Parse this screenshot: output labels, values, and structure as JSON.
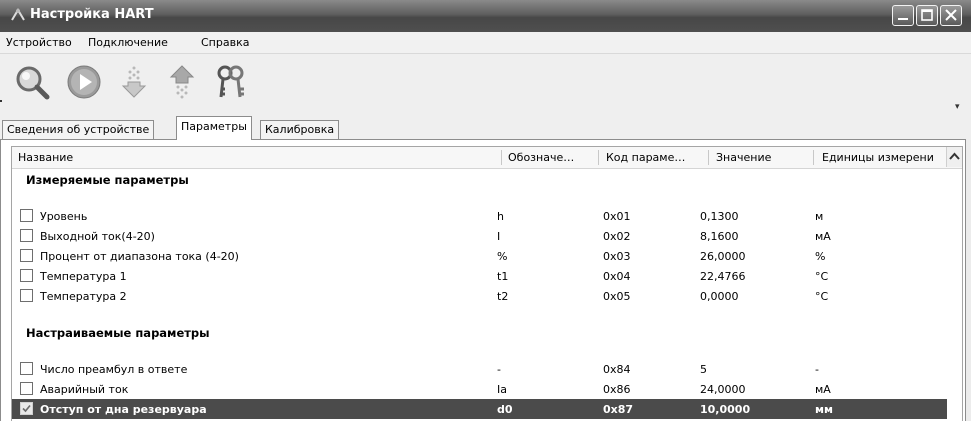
{
  "window": {
    "title": "Настройка HART"
  },
  "menu": {
    "items": [
      "Устройство",
      "Подключение",
      "Справка"
    ]
  },
  "toolbar": {
    "tools": [
      "search-icon",
      "play-icon",
      "download-arrow-icon",
      "upload-arrow-icon",
      "keys-icon"
    ],
    "overflow": "▾"
  },
  "tabs": {
    "items": [
      "Сведения об устройстве",
      "Параметры",
      "Калибровка"
    ],
    "active": "Параметры"
  },
  "table": {
    "columns": [
      "Название",
      "Обозначе…",
      "Код параме…",
      "Значение",
      "Единицы измерени"
    ],
    "groups": [
      {
        "label": "Измеряемые параметры",
        "rows": [
          {
            "name": "Уровень",
            "symbol": "h",
            "code": "0x01",
            "value": "0,1300",
            "unit": "м",
            "checked": false
          },
          {
            "name": "Выходной ток(4-20)",
            "symbol": "I",
            "code": "0x02",
            "value": "8,1600",
            "unit": "мА",
            "checked": false
          },
          {
            "name": "Процент от диапазона тока (4-20)",
            "symbol": "%",
            "code": "0x03",
            "value": "26,0000",
            "unit": "%",
            "checked": false
          },
          {
            "name": "Температура 1",
            "symbol": "t1",
            "code": "0x04",
            "value": "22,4766",
            "unit": "°C",
            "checked": false
          },
          {
            "name": "Температура 2",
            "symbol": "t2",
            "code": "0x05",
            "value": "0,0000",
            "unit": "°C",
            "checked": false
          }
        ]
      },
      {
        "label": "Настраиваемые параметры",
        "rows": [
          {
            "name": "Число преамбул в ответе",
            "symbol": "-",
            "code": "0x84",
            "value": "5",
            "unit": "-",
            "checked": false
          },
          {
            "name": "Аварийный ток",
            "symbol": "Ia",
            "code": "0x86",
            "value": "24,0000",
            "unit": "мА",
            "checked": false
          },
          {
            "name": "Отступ от дна резервуара",
            "symbol": "d0",
            "code": "0x87",
            "value": "10,0000",
            "unit": "мм",
            "checked": true,
            "selected": true
          }
        ]
      }
    ]
  },
  "colors": {
    "titlebar": "#5e5e5e",
    "selection": "#4b4b4b"
  }
}
